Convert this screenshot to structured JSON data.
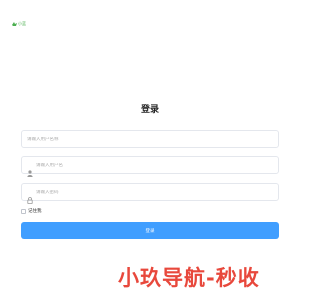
{
  "header": {
    "logo_text": "小蓝"
  },
  "page_title": "登录",
  "form": {
    "field1_placeholder": "请输入用户名称",
    "field2_placeholder": "请输入用户名",
    "field3_placeholder": "请输入密码",
    "remember_label": "记住我",
    "submit_label": "登录"
  },
  "watermark": {
    "text": "小玖导航-秒收"
  },
  "colors": {
    "accent": "#409eff",
    "logo": "#4caf50",
    "watermark": "#e8483c"
  },
  "icons": {
    "field2": "user-icon",
    "field3": "lock-icon"
  }
}
